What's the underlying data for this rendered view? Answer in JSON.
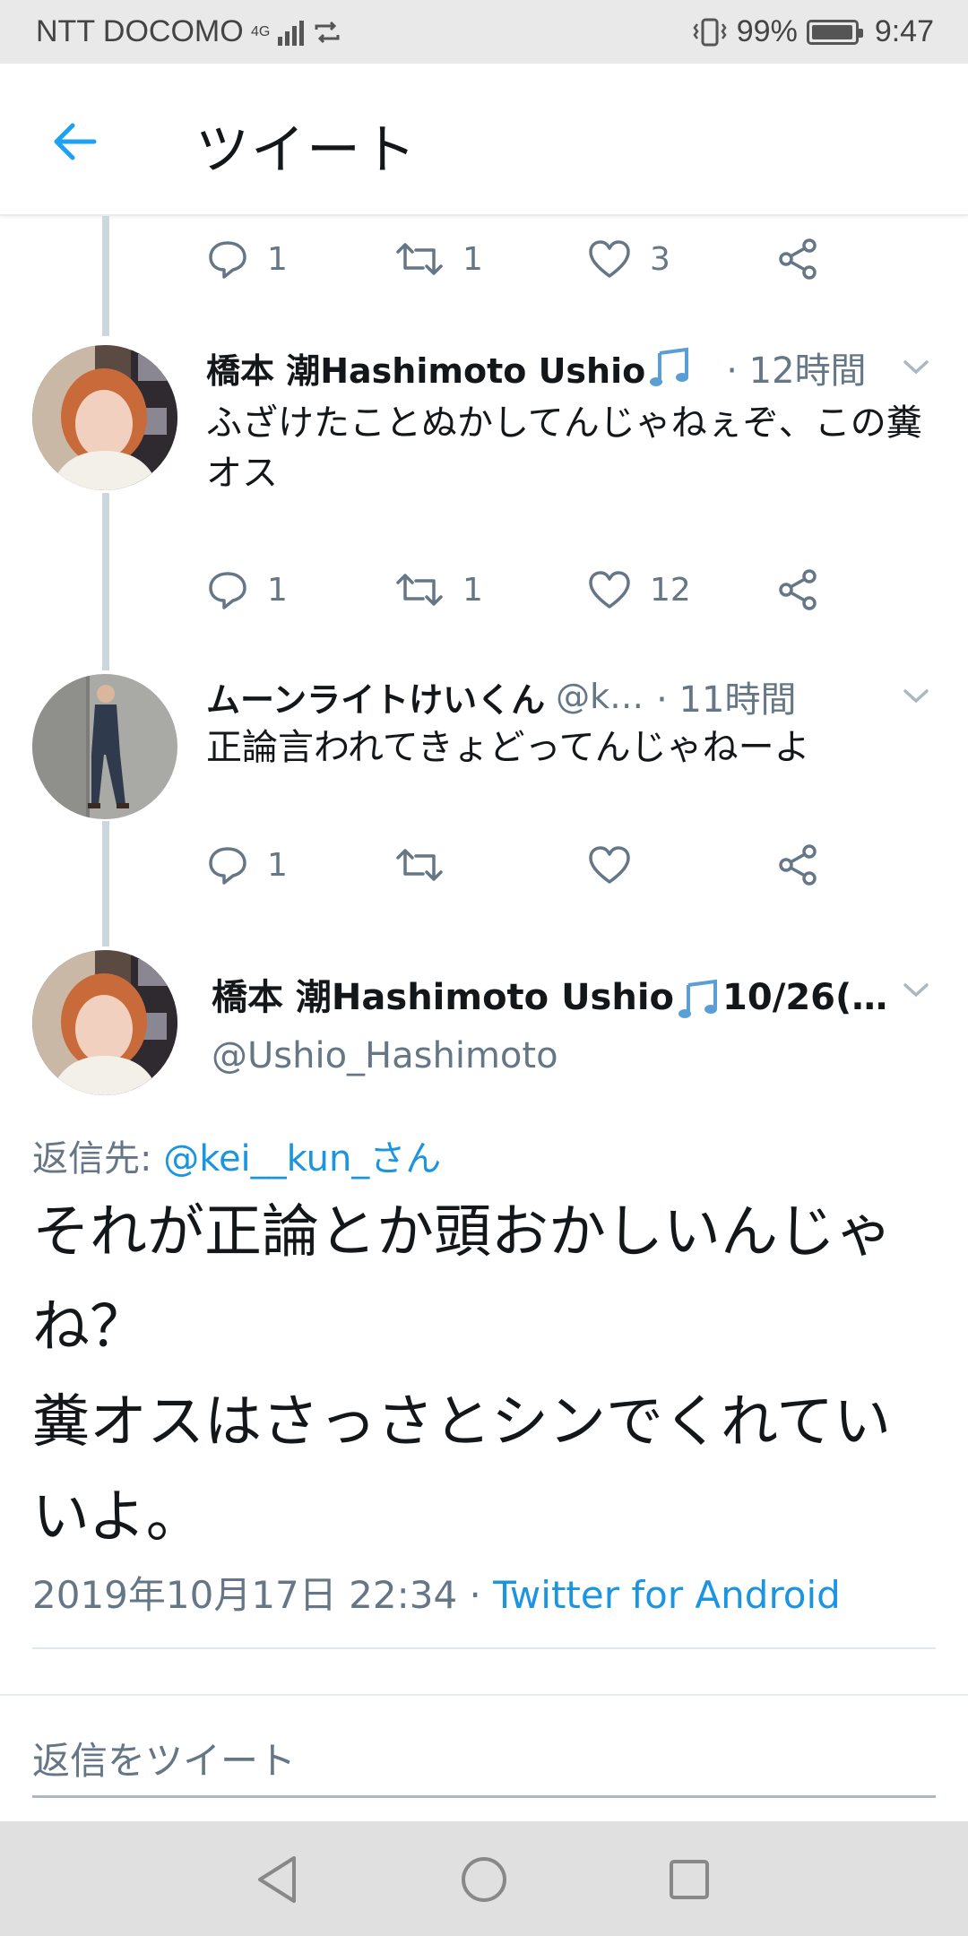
{
  "status_bar": {
    "carrier": "NTT DOCOMO",
    "network": "4G",
    "battery": "99%",
    "battery_level": 0.99,
    "time": "9:47"
  },
  "header": {
    "title": "ツイート",
    "back_icon": "arrow-left-icon",
    "accent": "#1da1f2"
  },
  "tweets": [
    {
      "actions": {
        "reply": "1",
        "retweet": "1",
        "like": "3"
      }
    },
    {
      "name": "橋本 潮Hashimoto Ushio",
      "time": "· 12時間",
      "text": "ふざけたことぬかしてんじゃねぇぞ、この糞オス",
      "actions": {
        "reply": "1",
        "retweet": "1",
        "like": "12"
      }
    },
    {
      "name": "ムーンライトけいくん",
      "handle": "@k…",
      "time": "· 11時間",
      "text": "正論言われてきょどってんじゃねーよ",
      "actions": {
        "reply": "1",
        "retweet": "",
        "like": ""
      }
    }
  ],
  "main_tweet": {
    "name": "橋本 潮Hashimoto Ushio",
    "name_suffix": "10/26(…",
    "handle": "@Ushio_Hashimoto",
    "reply_prefix": "返信先: ",
    "reply_mention": "@kei__kun_さん",
    "text": "それが正論とか頭おかしいんじゃね？\n糞オスはさっさとシンでくれていいよ。",
    "date": "2019年10月17日 22:34 · ",
    "source": "Twitter for Android",
    "link_color": "#1b95e0"
  },
  "reply_bar": {
    "placeholder": "返信をツイート"
  }
}
